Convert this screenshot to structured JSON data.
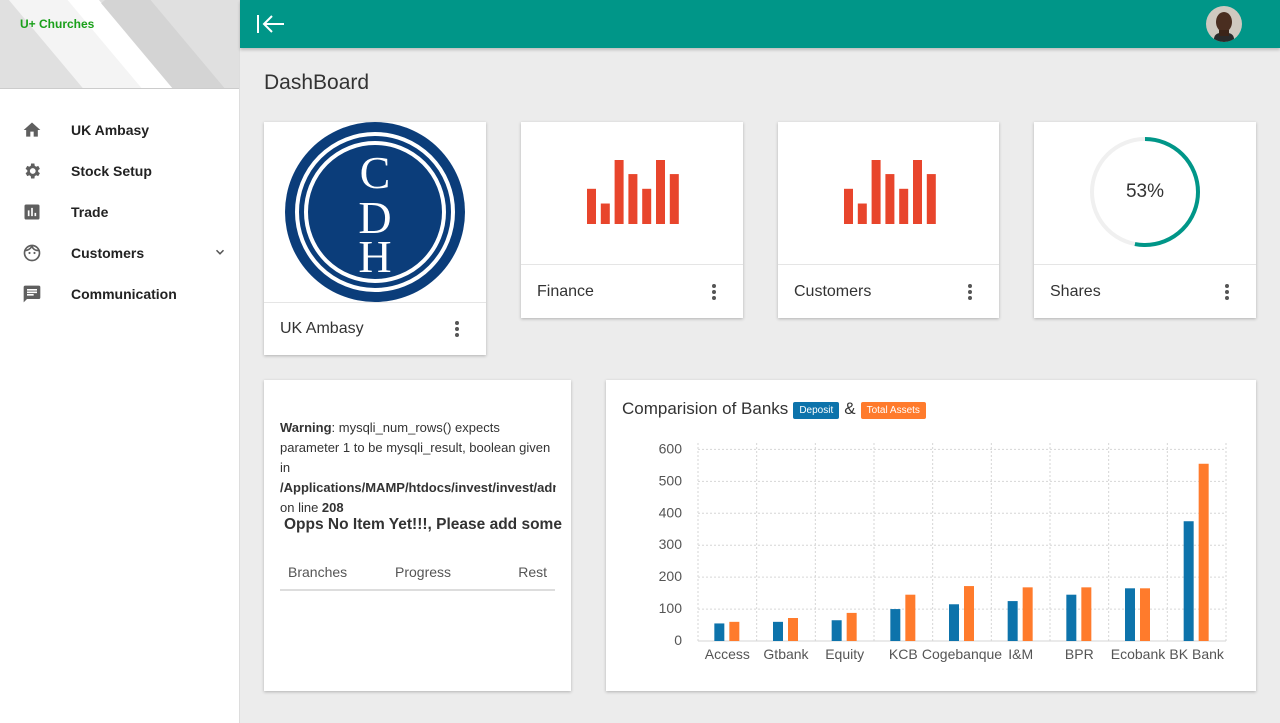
{
  "app": {
    "brand": "U+ Churches"
  },
  "sidebar": {
    "items": [
      {
        "label": "UK Ambasy",
        "icon": "home-icon"
      },
      {
        "label": "Stock Setup",
        "icon": "gear-icon"
      },
      {
        "label": "Trade",
        "icon": "bar-chart-icon"
      },
      {
        "label": "Customers",
        "icon": "face-icon",
        "expandable": true
      },
      {
        "label": "Communication",
        "icon": "message-icon"
      }
    ]
  },
  "page": {
    "title": "DashBoard"
  },
  "cards": {
    "ambasy": {
      "title": "UK Ambasy",
      "logo_text": [
        "C",
        "D",
        "H"
      ]
    },
    "finance": {
      "title": "Finance"
    },
    "customers": {
      "title": "Customers"
    },
    "shares": {
      "title": "Shares",
      "percent_label": "53%",
      "progress": 0.53
    }
  },
  "mini_bars": [
    0.55,
    0.32,
    1.0,
    0.78,
    0.55,
    1.0,
    0.78
  ],
  "warning": {
    "label": "Warning",
    "message": ": mysqli_num_rows() expects parameter 1 to be mysqli_result, boolean given in",
    "path": "/Applications/MAMP/htdocs/invest/invest/admin/index.php",
    "line_prefix": " on line ",
    "line": "208",
    "empty_text": "Opps No Item Yet!!!, Please add some",
    "columns": [
      "Branches",
      "Progress",
      "Rest"
    ]
  },
  "chart": {
    "title": "Comparision of Banks",
    "amp": "&",
    "deposit_label": "Deposit",
    "assets_label": "Total Assets"
  },
  "colors": {
    "primary": "#009688",
    "accent_red": "#e8452c",
    "deposit": "#0d73ab",
    "assets": "#ff7b2c",
    "logo_blue": "#0b3d7a"
  },
  "chart_data": {
    "type": "bar",
    "categories": [
      "Access",
      "Gtbank",
      "Equity",
      "KCB",
      "Cogebanque",
      "I&M",
      "BPR",
      "Ecobank",
      "BK Bank"
    ],
    "series": [
      {
        "name": "Deposit",
        "values": [
          55,
          60,
          65,
          100,
          115,
          125,
          145,
          165,
          375
        ]
      },
      {
        "name": "Total Assets",
        "values": [
          60,
          72,
          88,
          145,
          172,
          168,
          168,
          165,
          555
        ]
      }
    ],
    "yticks": [
      0,
      100,
      200,
      300,
      400,
      500,
      600
    ],
    "ylim": [
      0,
      620
    ],
    "grid": true
  }
}
